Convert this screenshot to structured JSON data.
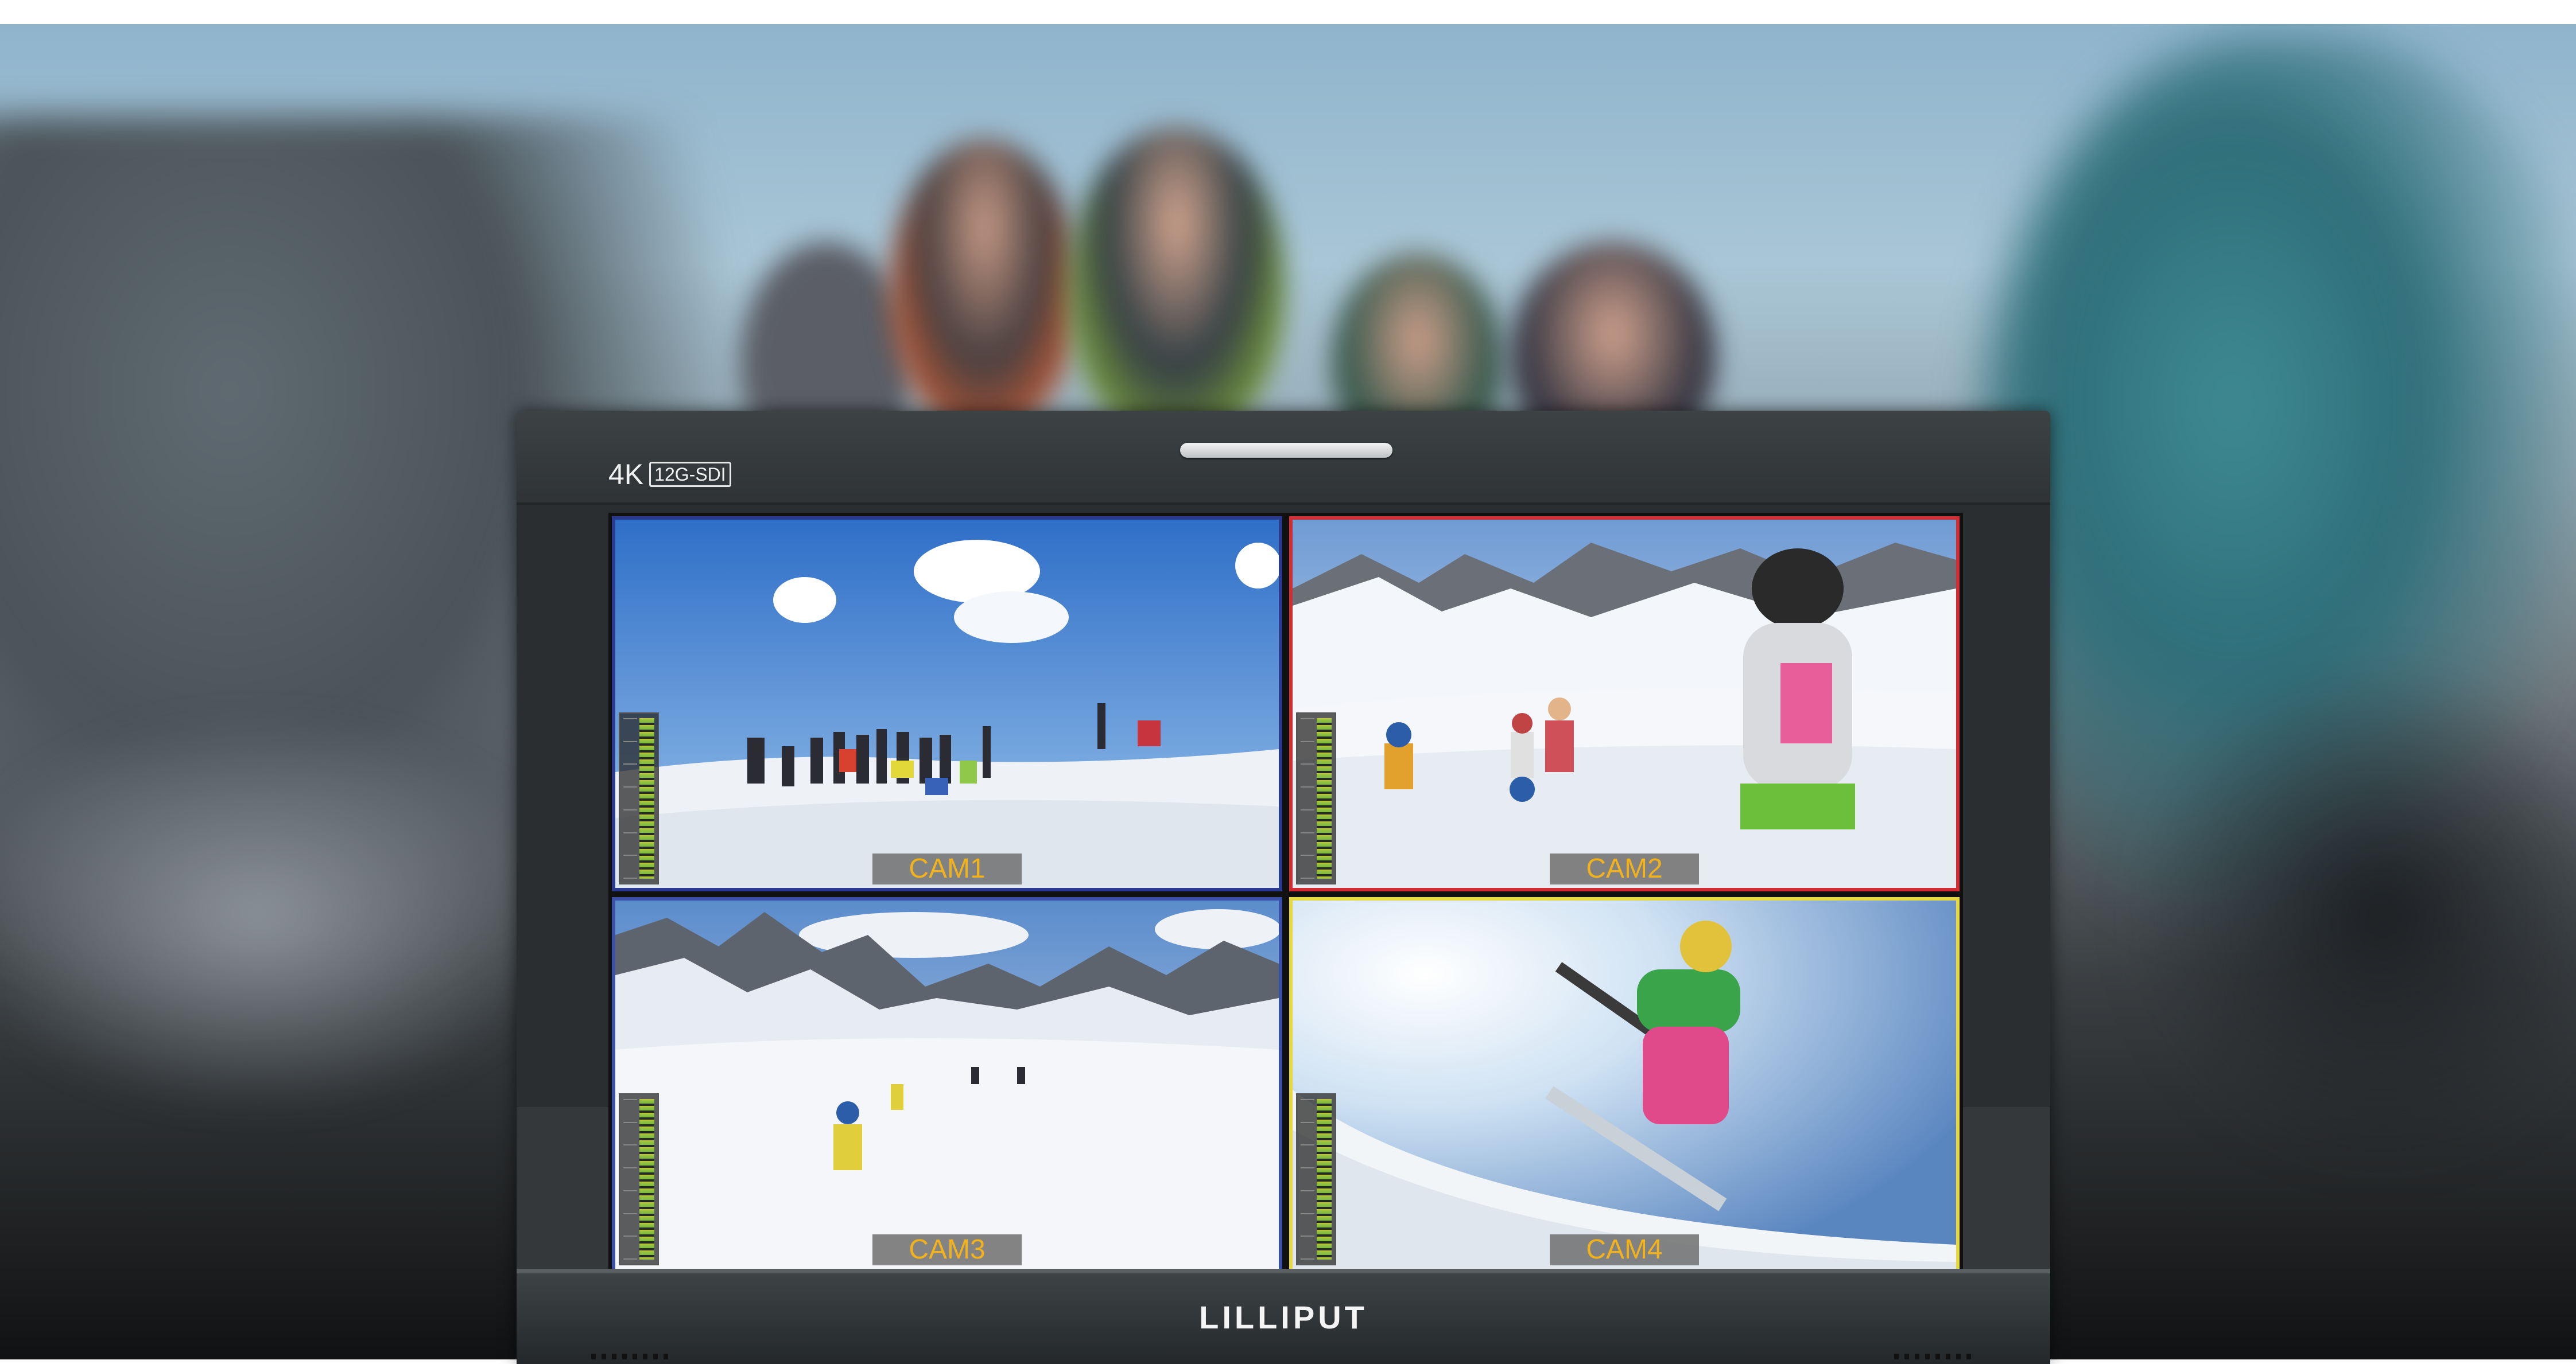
{
  "monitor": {
    "badge_resolution": "4K",
    "badge_interface": "12G-SDI",
    "brand_logo": "LILLIPUT"
  },
  "quad_view": {
    "tiles": [
      {
        "label": "CAM1",
        "border_color": "#2a3b8f"
      },
      {
        "label": "CAM2",
        "border_color": "#d02e33"
      },
      {
        "label": "CAM3",
        "border_color": "#3a4fa8"
      },
      {
        "label": "CAM4",
        "border_color": "#e6d940"
      }
    ],
    "label_color": "#f2b21c"
  }
}
